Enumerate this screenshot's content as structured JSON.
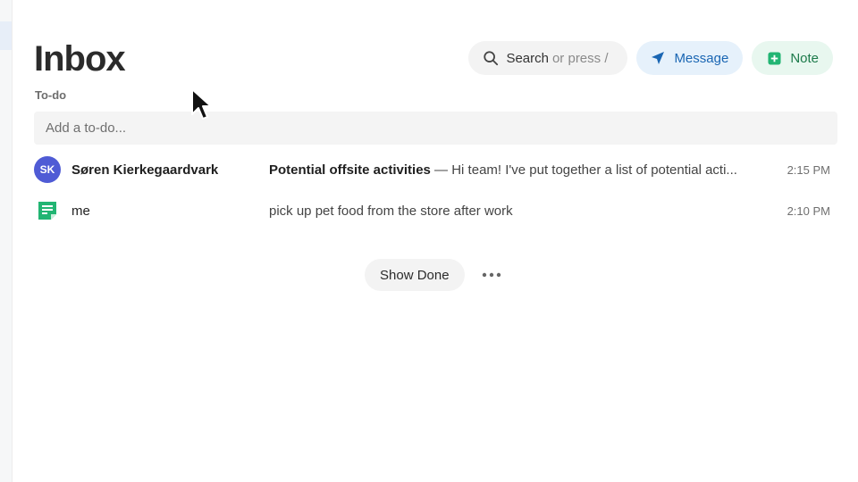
{
  "page": {
    "title": "Inbox"
  },
  "sections": {
    "todo_label": "To-do"
  },
  "header": {
    "search": {
      "label": "Search",
      "hint": "or press /",
      "icon": "search-icon"
    },
    "message_button": {
      "label": "Message",
      "icon": "send-icon"
    },
    "note_button": {
      "label": "Note",
      "icon": "note-plus-icon"
    }
  },
  "todo_input": {
    "placeholder": "Add a to-do...",
    "value": ""
  },
  "items": [
    {
      "avatar_initials": "SK",
      "sender": "Søren Kierkegaardvark",
      "subject": "Potential offsite activities",
      "preview": " — Hi team! I've put together a list of potential acti...",
      "time": "2:15 PM"
    },
    {
      "avatar_icon": "note-icon",
      "sender": "me",
      "subject": "",
      "preview": "pick up pet food from the store after work",
      "time": "2:10 PM"
    }
  ],
  "footer": {
    "show_done_label": "Show Done",
    "more_icon": "more-horizontal-icon"
  },
  "colors": {
    "avatar_bg": "#4f5bd5",
    "message_accent": "#1a66b3",
    "note_accent": "#1c7a4a",
    "note_icon": "#22b573"
  }
}
